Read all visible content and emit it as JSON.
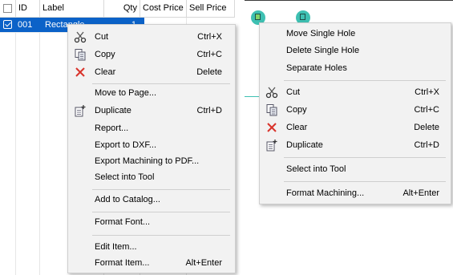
{
  "grid": {
    "columns": [
      "ID",
      "Label",
      "Qty",
      "Cost Price",
      "Sell Price"
    ],
    "selected_row": {
      "id": "001",
      "label": "Rectangle",
      "qty": "1"
    }
  },
  "context_menu_item": {
    "items": [
      {
        "label": "Cut",
        "shortcut": "Ctrl+X",
        "icon": "scissors-icon"
      },
      {
        "label": "Copy",
        "shortcut": "Ctrl+C",
        "icon": "copy-icon"
      },
      {
        "label": "Clear",
        "shortcut": "Delete",
        "icon": "clear-x-icon"
      },
      {
        "label": "Move to Page...",
        "shortcut": ""
      },
      {
        "label": "Duplicate",
        "shortcut": "Ctrl+D",
        "icon": "duplicate-icon"
      },
      {
        "label": "Report...",
        "shortcut": ""
      },
      {
        "label": "Export to DXF...",
        "shortcut": ""
      },
      {
        "label": "Export Machining to PDF...",
        "shortcut": ""
      },
      {
        "label": "Select into Tool",
        "shortcut": ""
      },
      {
        "label": "Add to Catalog...",
        "shortcut": ""
      },
      {
        "label": "Format Font...",
        "shortcut": ""
      },
      {
        "label": "Edit Item...",
        "shortcut": ""
      },
      {
        "label": "Format Item...",
        "shortcut": "Alt+Enter"
      }
    ]
  },
  "context_menu_hole": {
    "items": [
      {
        "label": "Move Single Hole",
        "shortcut": ""
      },
      {
        "label": "Delete Single Hole",
        "shortcut": ""
      },
      {
        "label": "Separate Holes",
        "shortcut": ""
      },
      {
        "label": "Cut",
        "shortcut": "Ctrl+X",
        "icon": "scissors-icon"
      },
      {
        "label": "Copy",
        "shortcut": "Ctrl+C",
        "icon": "copy-icon"
      },
      {
        "label": "Clear",
        "shortcut": "Delete",
        "icon": "clear-x-icon"
      },
      {
        "label": "Duplicate",
        "shortcut": "Ctrl+D",
        "icon": "duplicate-icon"
      },
      {
        "label": "Select into Tool",
        "shortcut": ""
      },
      {
        "label": "Format Machining...",
        "shortcut": "Alt+Enter"
      }
    ]
  },
  "colors": {
    "selection": "#0b62c8",
    "hole_fill": "#3ec0b2",
    "clear_icon": "#d9332b",
    "menu_bg": "#f2f2f2"
  }
}
